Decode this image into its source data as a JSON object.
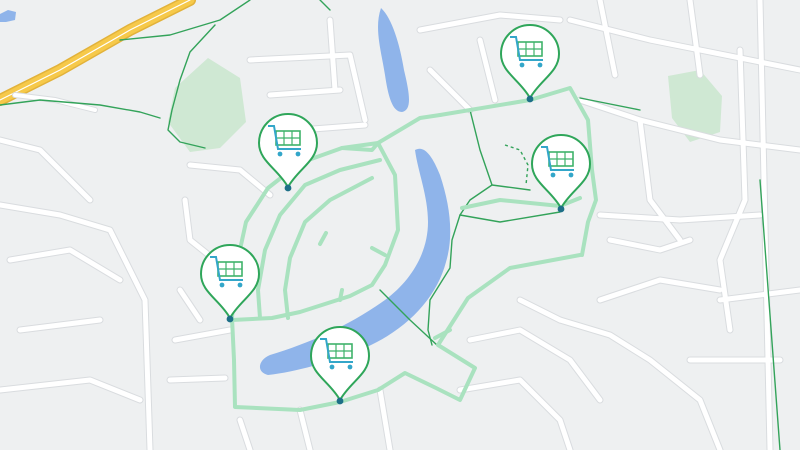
{
  "map": {
    "colors": {
      "background": "#eef0f1",
      "street": "#ffffff",
      "street_casing": "#d9dcdf",
      "highway": "#f6c94a",
      "highway_casing": "#e2b23a",
      "water": "#8fb4ea",
      "park": "#cfe8d3",
      "trail": "#33a35a",
      "route": "#a9e2bf",
      "pin_border": "#2fa65a",
      "pin_fill": "#ffffff",
      "cart_icon": "#33a6c9",
      "cart_grid": "#3fb26a",
      "pin_dot": "#1d6f87"
    },
    "markers": [
      {
        "name": "shopping-cart-marker-1",
        "icon": "shopping-cart-icon"
      },
      {
        "name": "shopping-cart-marker-2",
        "icon": "shopping-cart-icon"
      },
      {
        "name": "shopping-cart-marker-3",
        "icon": "shopping-cart-icon"
      },
      {
        "name": "shopping-cart-marker-4",
        "icon": "shopping-cart-icon"
      },
      {
        "name": "shopping-cart-marker-5",
        "icon": "shopping-cart-icon"
      }
    ]
  }
}
